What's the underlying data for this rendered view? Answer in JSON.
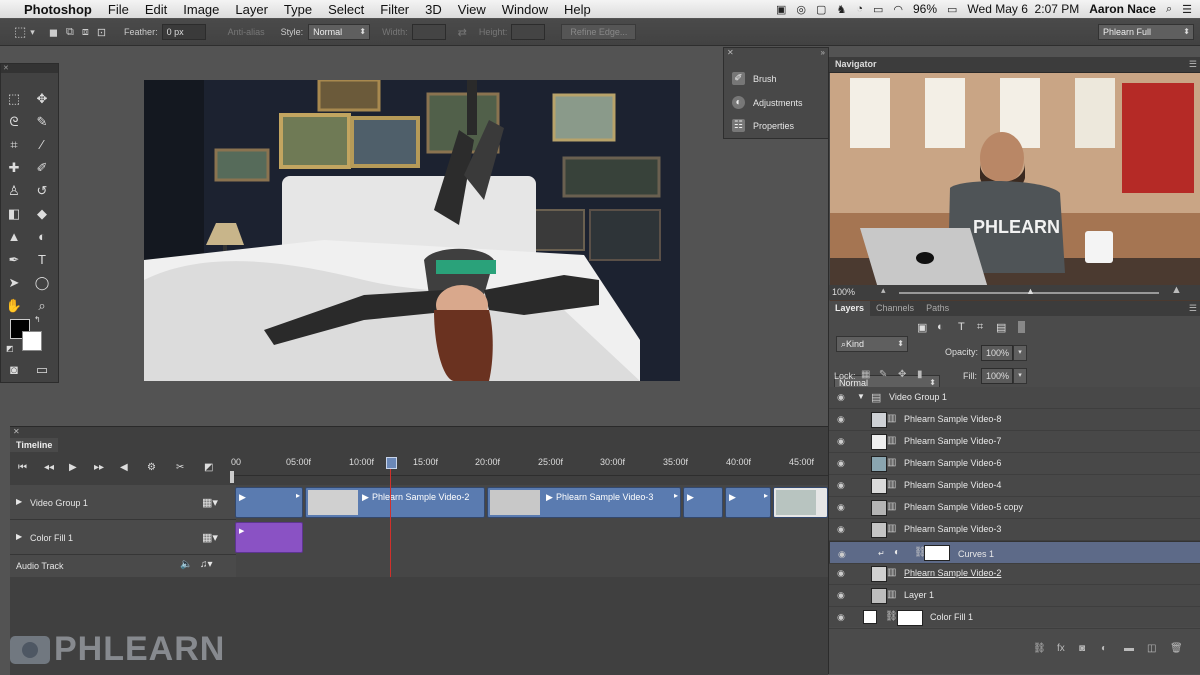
{
  "menubar": {
    "apple": "",
    "app": "Photoshop",
    "items": [
      "File",
      "Edit",
      "Image",
      "Layer",
      "Type",
      "Select",
      "Filter",
      "3D",
      "View",
      "Window",
      "Help"
    ],
    "battery": "96%",
    "datetime": "Wed May 6  2:07 PM",
    "user": "Aaron Nace"
  },
  "options": {
    "feather_label": "Feather:",
    "feather_value": "0 px",
    "antialias_label": "Anti-alias",
    "style_label": "Style:",
    "style_value": "Normal",
    "width_label": "Width:",
    "height_label": "Height:",
    "refine_label": "Refine Edge...",
    "workspace_value": "Phlearn Full"
  },
  "minipanel": {
    "items": [
      "Brush",
      "Adjustments",
      "Properties"
    ]
  },
  "navigator": {
    "title": "Navigator",
    "zoom": "100%",
    "shirt_text": "PHLEARN"
  },
  "layers_panel": {
    "tabs": [
      "Layers",
      "Channels",
      "Paths"
    ],
    "kind_label": "Kind",
    "blend_mode": "Normal",
    "opacity_label": "Opacity:",
    "opacity_value": "100%",
    "lock_label": "Lock:",
    "fill_label": "Fill:",
    "fill_value": "100%",
    "layers": [
      {
        "name": "Video Group 1",
        "type": "group"
      },
      {
        "name": "Phlearn Sample Video-8",
        "type": "video"
      },
      {
        "name": "Phlearn Sample Video-7",
        "type": "video"
      },
      {
        "name": "Phlearn Sample Video-6",
        "type": "video"
      },
      {
        "name": "Phlearn Sample Video-4",
        "type": "video"
      },
      {
        "name": "Phlearn Sample Video-5 copy",
        "type": "video"
      },
      {
        "name": "Phlearn Sample Video-3",
        "type": "video"
      },
      {
        "name": "Curves 1",
        "type": "adjustment"
      },
      {
        "name": "Phlearn Sample Video-2",
        "type": "video"
      },
      {
        "name": "Layer 1",
        "type": "video"
      },
      {
        "name": "Color Fill 1",
        "type": "fill"
      }
    ]
  },
  "timeline": {
    "title": "Timeline",
    "ruler": [
      "00",
      "05:00f",
      "10:00f",
      "15:00f",
      "20:00f",
      "25:00f",
      "30:00f",
      "35:00f",
      "40:00f",
      "45:00f"
    ],
    "tracks": [
      "Video Group 1",
      "Color Fill 1",
      "Audio Track"
    ],
    "clips": [
      "Phlearn Sample Video-2",
      "Phlearn Sample Video-3"
    ]
  },
  "watermark": "PHLEARN",
  "colors": {
    "clip_blue": "#5a7bb0",
    "fill_purple": "#8a52c4",
    "playhead": "#d0302b",
    "selected_row": "#5d6a88"
  }
}
